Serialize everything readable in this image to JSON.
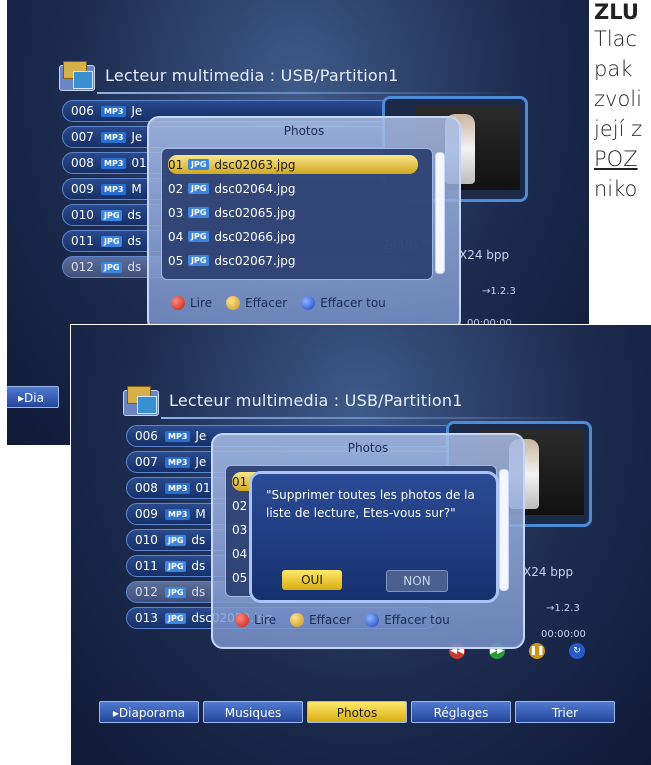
{
  "doc": {
    "heading": "ZLU",
    "lines": [
      "Tlac",
      "pak",
      "zvoli",
      "její z",
      "POZ",
      "niko"
    ]
  },
  "screen1": {
    "title": "Lecteur multimedia : USB/Partition1",
    "files": [
      {
        "num": "006",
        "type": "MP3",
        "name": "Je"
      },
      {
        "num": "007",
        "type": "MP3",
        "name": "Je"
      },
      {
        "num": "008",
        "type": "MP3",
        "name": "01"
      },
      {
        "num": "009",
        "type": "MP3",
        "name": "M"
      },
      {
        "num": "010",
        "type": "JPG",
        "name": "ds"
      },
      {
        "num": "011",
        "type": "JPG",
        "name": "ds"
      },
      {
        "num": "012",
        "type": "JPG",
        "name": "ds"
      }
    ],
    "popup": {
      "title": "Photos",
      "items": [
        {
          "num": "01",
          "type": "JPG",
          "name": "dsc02063.jpg"
        },
        {
          "num": "02",
          "type": "JPG",
          "name": "dsc02064.jpg"
        },
        {
          "num": "03",
          "type": "JPG",
          "name": "dsc02065.jpg"
        },
        {
          "num": "04",
          "type": "JPG",
          "name": "dsc02066.jpg"
        },
        {
          "num": "05",
          "type": "JPG",
          "name": "dsc02067.jpg"
        }
      ],
      "legend": {
        "red": "Lire",
        "yellow": "Effacer",
        "blue": "Effacer tou"
      }
    },
    "info": {
      "res": "X24 bpp",
      "size": "2448x",
      "page": "→1.2.3",
      "time": "00:00:00"
    },
    "diaporama_label": "▸Dia"
  },
  "screen2": {
    "title": "Lecteur multimedia : USB/Partition1",
    "files": [
      {
        "num": "006",
        "type": "MP3",
        "name": "Je"
      },
      {
        "num": "007",
        "type": "MP3",
        "name": "Je"
      },
      {
        "num": "008",
        "type": "MP3",
        "name": "01"
      },
      {
        "num": "009",
        "type": "MP3",
        "name": "M"
      },
      {
        "num": "010",
        "type": "JPG",
        "name": "ds"
      },
      {
        "num": "011",
        "type": "JPG",
        "name": "ds"
      },
      {
        "num": "012",
        "type": "JPG",
        "name": "ds"
      },
      {
        "num": "013",
        "type": "JPG",
        "name": "dsc02059.jpg"
      }
    ],
    "popup": {
      "title": "Photos",
      "item_nums": [
        "01",
        "02",
        "03",
        "04",
        "05"
      ],
      "legend": {
        "red": "Lire",
        "yellow": "Effacer",
        "blue": "Effacer tou"
      }
    },
    "confirm": {
      "message": "\"Supprimer toutes les photos de la liste de lecture, Etes-vous sur?\"",
      "yes": "OUI",
      "no": "NON"
    },
    "info": {
      "res": "X24 bpp",
      "page": "→1.2.3",
      "time": "00:00:00"
    },
    "buttons": [
      "▸Diaporama",
      "Musiques",
      "Photos",
      "Réglages",
      "Trier"
    ],
    "active_button": "Photos"
  }
}
